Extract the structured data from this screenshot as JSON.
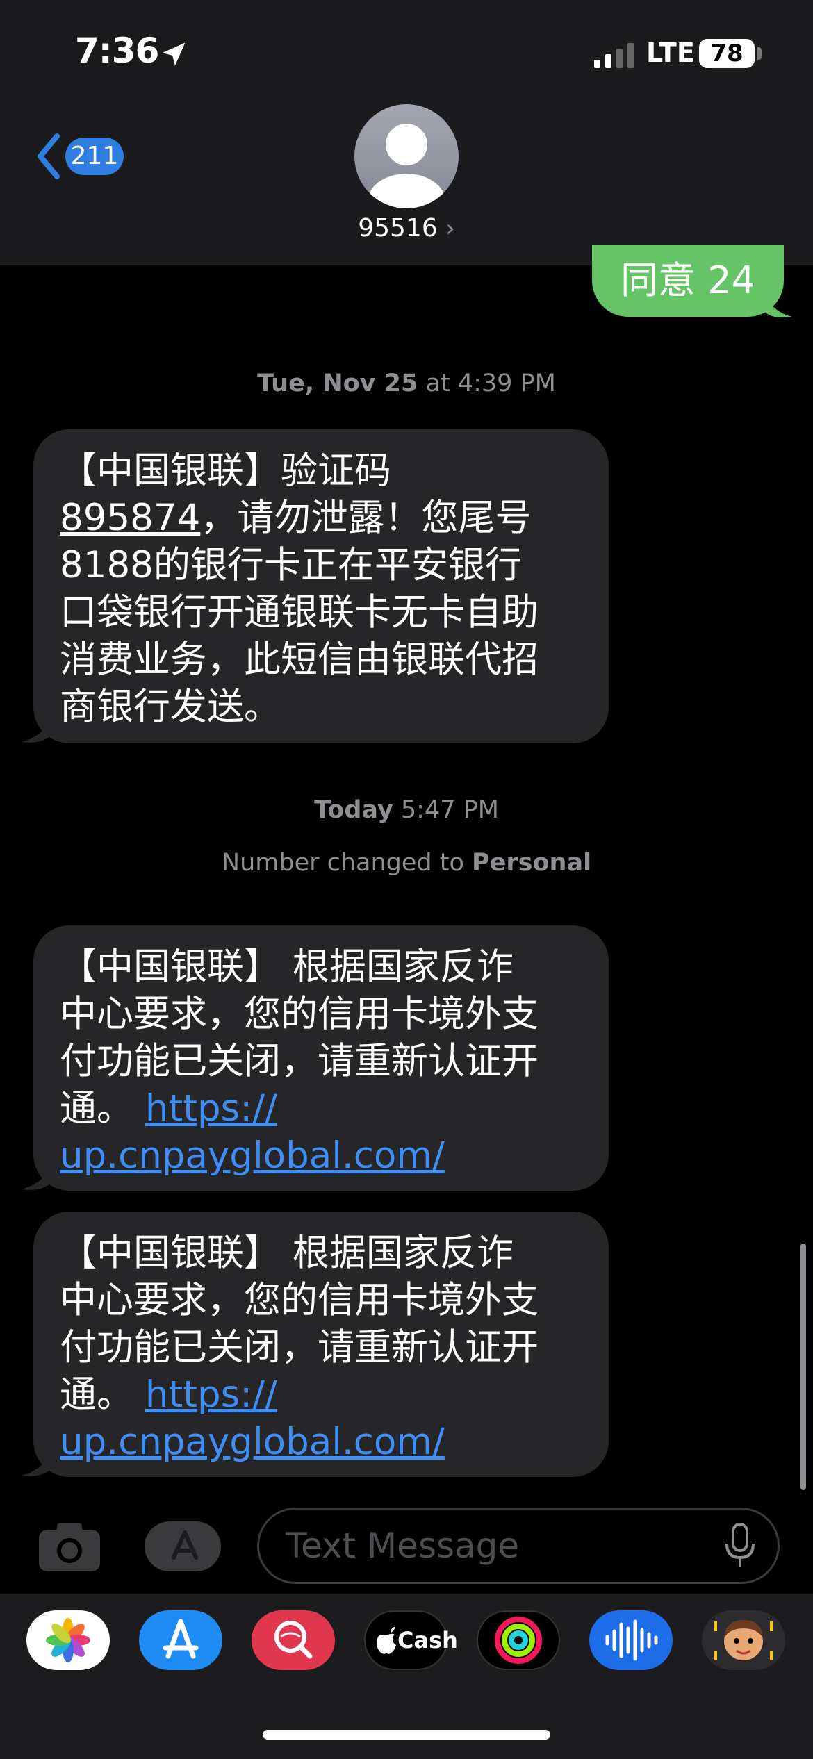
{
  "status_bar": {
    "time": "7:36",
    "network": "LTE",
    "battery": "78"
  },
  "header": {
    "back_count": "211",
    "contact": "95516",
    "contact_chevron": "›"
  },
  "messages": {
    "sent_partial": "同意 24",
    "timestamp1_day": "Tue, Nov 25",
    "timestamp1_time": " at 4:39 PM",
    "msg1_line1": "【中国银联】验证码",
    "msg1_code": "895874",
    "msg1_line2_rest": "，请勿泄露！您尾号",
    "msg1_line3": "8188的银行卡正在平安银行",
    "msg1_line4": "口袋银行开通银联卡无卡自助",
    "msg1_line5": "消费业务，此短信由银联代招",
    "msg1_line6": "商银行发送。",
    "timestamp2_day": "Today",
    "timestamp2_time": " 5:47 PM",
    "notice_prefix": "Number changed to ",
    "notice_value": "Personal",
    "msg2_line1": "【中国银联】 根据国家反诈",
    "msg2_line2": "中心要求，您的信用卡境外支",
    "msg2_line3": "付功能已关闭，请重新认证开",
    "msg2_line4_text": "通。 ",
    "msg2_link1": "https://",
    "msg2_link2": "up.cnpayglobal.com/",
    "msg3_line1": "【中国银联】 根据国家反诈",
    "msg3_line2": "中心要求，您的信用卡境外支",
    "msg3_line3": "付功能已关闭，请重新认证开",
    "msg3_line4_text": "通。 ",
    "msg3_link1": "https://",
    "msg3_link2": "up.cnpayglobal.com/"
  },
  "input": {
    "placeholder": "Text Message"
  },
  "drawer": {
    "cash_label": "Cash"
  },
  "colors": {
    "sent_bubble": "#65c466",
    "received_bubble": "#262629",
    "link": "#3f8ef5",
    "accent": "#2f7de1"
  },
  "icons": [
    "location-arrow-icon",
    "signal-icon",
    "back-chevron-icon",
    "contact-avatar-icon",
    "camera-icon",
    "app-store-icon",
    "microphone-icon",
    "photos-app-icon",
    "app-store-app-icon",
    "search-images-app-icon",
    "apple-cash-app-icon",
    "fitness-app-icon",
    "audio-app-icon",
    "memoji-app-icon"
  ]
}
